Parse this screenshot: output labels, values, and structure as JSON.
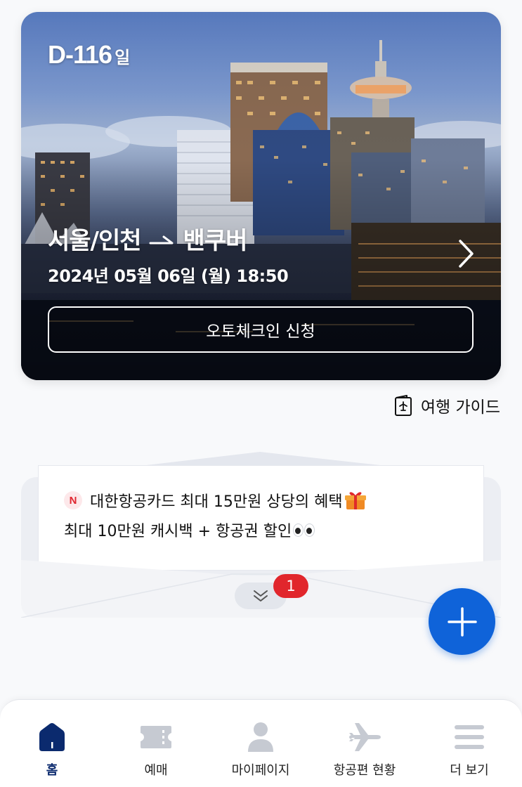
{
  "trip": {
    "dday_number": "D-116",
    "dday_unit": "일",
    "origin": "서울/인천",
    "destination": "밴쿠버",
    "datetime": "2024년 05월 06일 (월) 18:50",
    "checkin_button": "오토체크인 신청"
  },
  "guide": {
    "label": "여행 가이드"
  },
  "promo": {
    "badge": "N",
    "line1": "대한항공카드 최대 15만원 상당의 혜택",
    "line2": "최대 10만원 캐시백 + 항공권 할인",
    "count": "1"
  },
  "nav": {
    "items": [
      {
        "label": "홈",
        "icon": "home-icon",
        "active": true
      },
      {
        "label": "예매",
        "icon": "ticket-icon",
        "active": false
      },
      {
        "label": "마이페이지",
        "icon": "person-icon",
        "active": false
      },
      {
        "label": "항공편 현황",
        "icon": "airplane-icon",
        "active": false
      },
      {
        "label": "더 보기",
        "icon": "menu-icon",
        "active": false
      }
    ]
  },
  "colors": {
    "accent": "#0f63d9",
    "nav_active": "#0b2a6e",
    "nav_inactive": "#c6cad2",
    "badge_red": "#e1262c"
  }
}
